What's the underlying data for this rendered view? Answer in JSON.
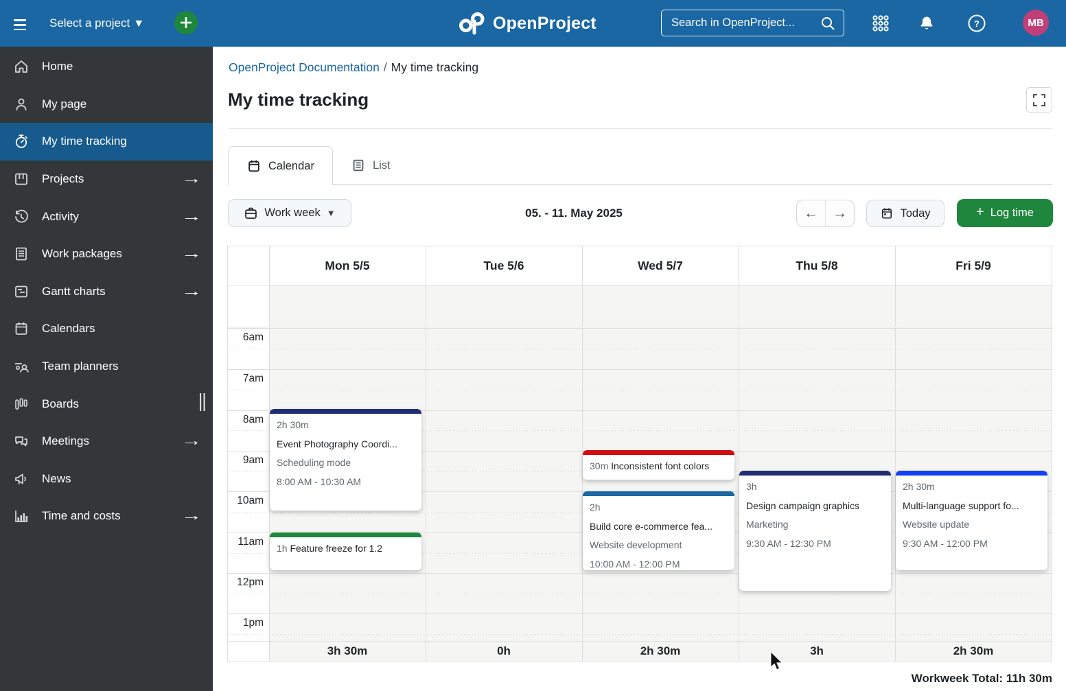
{
  "header": {
    "select_project": "Select a project",
    "logo": "OpenProject",
    "search_placeholder": "Search in OpenProject...",
    "avatar_initials": "MB"
  },
  "sidebar": {
    "items": [
      {
        "label": "Home"
      },
      {
        "label": "My page"
      },
      {
        "label": "My time tracking"
      },
      {
        "label": "Projects"
      },
      {
        "label": "Activity"
      },
      {
        "label": "Work packages"
      },
      {
        "label": "Gantt charts"
      },
      {
        "label": "Calendars"
      },
      {
        "label": "Team planners"
      },
      {
        "label": "Boards"
      },
      {
        "label": "Meetings"
      },
      {
        "label": "News"
      },
      {
        "label": "Time and costs"
      }
    ]
  },
  "breadcrumb": {
    "parent": "OpenProject Documentation",
    "separator": "/",
    "current": "My time tracking"
  },
  "page": {
    "title": "My time tracking"
  },
  "tabs": {
    "calendar": "Calendar",
    "list": "List"
  },
  "toolbar": {
    "view_mode": "Work week",
    "date_range": "05. - 11. May 2025",
    "today_label": "Today",
    "log_time_label": "Log time"
  },
  "calendar": {
    "days": [
      {
        "label": "Mon 5/5",
        "total": "3h 30m"
      },
      {
        "label": "Tue 5/6",
        "total": "0h"
      },
      {
        "label": "Wed 5/7",
        "total": "2h 30m"
      },
      {
        "label": "Thu 5/8",
        "total": "3h"
      },
      {
        "label": "Fri 5/9",
        "total": "2h 30m"
      }
    ],
    "time_labels": [
      "6am",
      "7am",
      "8am",
      "9am",
      "10am",
      "11am",
      "12pm",
      "1pm"
    ],
    "events": [
      {
        "duration": "2h 30m",
        "title": "Event Photography Coordi...",
        "project": "Scheduling mode",
        "time": "8:00 AM - 10:30 AM",
        "color": "#222e72"
      },
      {
        "duration": "1h",
        "title": "Feature freeze for 1.2",
        "color": "#1f873d"
      },
      {
        "duration": "30m",
        "title": "Inconsistent font colors",
        "color": "#d01010"
      },
      {
        "duration": "2h",
        "title": "Build core e-commerce fea...",
        "project": "Website development",
        "time": "10:00 AM - 12:00 PM",
        "color": "#1a67a3"
      },
      {
        "duration": "3h",
        "title": "Design campaign graphics",
        "project": "Marketing",
        "time": "9:30 AM - 12:30 PM",
        "color": "#222e72"
      },
      {
        "duration": "2h 30m",
        "title": "Multi-language support fo...",
        "project": "Website update",
        "time": "9:30 AM - 12:00 PM",
        "color": "#1240f7"
      }
    ],
    "workweek_total": "Workweek Total: 11h 30m"
  }
}
